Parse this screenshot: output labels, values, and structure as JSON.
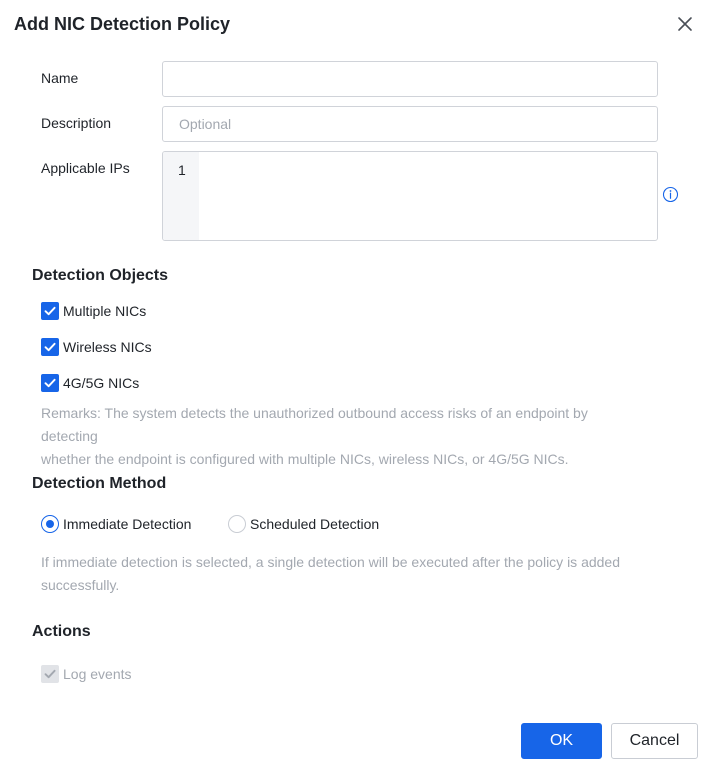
{
  "dialog": {
    "title": "Add NIC Detection Policy",
    "close_icon": "close-icon"
  },
  "form": {
    "name_label": "Name",
    "name_value": "",
    "description_label": "Description",
    "description_placeholder": "Optional",
    "description_value": "",
    "applicable_ips_label": "Applicable IPs",
    "applicable_ips_line_number": "1",
    "info_icon": "info-circle-icon"
  },
  "detection_objects": {
    "title": "Detection Objects",
    "items": [
      {
        "label": "Multiple NICs",
        "checked": true
      },
      {
        "label": "Wireless NICs",
        "checked": true
      },
      {
        "label": "4G/5G NICs",
        "checked": true
      }
    ],
    "remarks_line1": "Remarks: The system detects the unauthorized outbound access risks of an endpoint by detecting",
    "remarks_line2": "whether the endpoint is configured with multiple NICs, wireless NICs, or 4G/5G NICs."
  },
  "detection_method": {
    "title": "Detection Method",
    "options": [
      {
        "label": "Immediate Detection",
        "selected": true
      },
      {
        "label": "Scheduled Detection",
        "selected": false
      }
    ],
    "hint_line1": "If immediate detection is selected, a single detection will be executed after the policy is added",
    "hint_line2": "successfully."
  },
  "actions": {
    "title": "Actions",
    "log_events_label": "Log events",
    "log_events_checked": true,
    "log_events_disabled": true
  },
  "footer": {
    "ok_label": "OK",
    "cancel_label": "Cancel"
  },
  "colors": {
    "primary": "#1765e8",
    "text": "#1f2329",
    "muted": "#a3a8b0",
    "border": "#d0d3d9"
  }
}
